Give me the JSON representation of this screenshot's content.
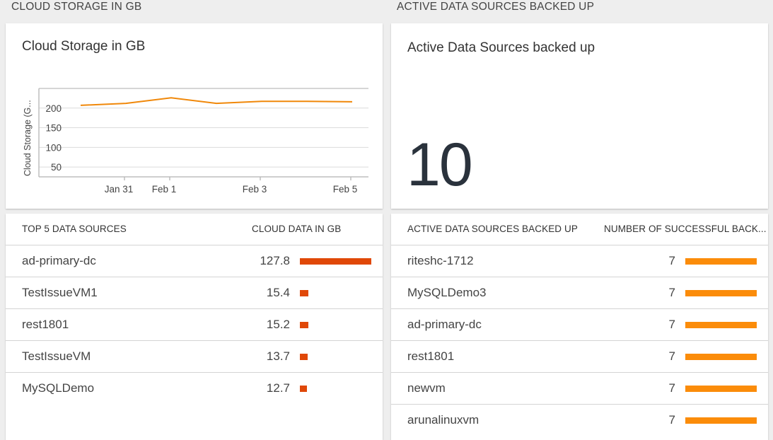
{
  "sections": {
    "left_title": "CLOUD STORAGE IN GB",
    "right_title": "ACTIVE DATA SOURCES BACKED UP"
  },
  "chart_card": {
    "title": "Cloud Storage in GB"
  },
  "chart_data": {
    "type": "line",
    "ylabel": "Cloud Storage (G...",
    "xlabel": "",
    "y_ticks": [
      "50",
      "100",
      "150",
      "200"
    ],
    "ylim": [
      25,
      250
    ],
    "x_ticks": [
      "Jan 31",
      "Feb 1",
      "Feb 3",
      "Feb 5"
    ],
    "series": [
      {
        "x": [
          "Jan 30",
          "Jan 31",
          "Feb 1",
          "Feb 2",
          "Feb 3",
          "Feb 4",
          "Feb 5"
        ],
        "values": [
          207,
          212,
          226,
          212,
          217,
          217,
          216
        ]
      }
    ],
    "grid": true,
    "line_color": "#f0880a"
  },
  "big_card": {
    "title": "Active Data Sources backed up",
    "value": "10"
  },
  "left_table": {
    "col1_header": "TOP 5 DATA SOURCES",
    "col2_header": "CLOUD DATA IN GB",
    "bar_color": "#e04808",
    "max": 127.8,
    "rows": [
      {
        "name": "ad-primary-dc",
        "value": "127.8",
        "num": 127.8
      },
      {
        "name": "TestIssueVM1",
        "value": "15.4",
        "num": 15.4
      },
      {
        "name": "rest1801",
        "value": "15.2",
        "num": 15.2
      },
      {
        "name": "TestIssueVM",
        "value": "13.7",
        "num": 13.7
      },
      {
        "name": "MySQLDemo",
        "value": "12.7",
        "num": 12.7
      }
    ]
  },
  "right_table": {
    "col1_header": "ACTIVE DATA SOURCES BACKED UP",
    "col2_header": "NUMBER OF SUCCESSFUL BACK...",
    "bar_color": "#fb8c0a",
    "max": 7,
    "rows": [
      {
        "name": "riteshc-1712",
        "value": "7",
        "num": 7
      },
      {
        "name": "MySQLDemo3",
        "value": "7",
        "num": 7
      },
      {
        "name": "ad-primary-dc",
        "value": "7",
        "num": 7
      },
      {
        "name": "rest1801",
        "value": "7",
        "num": 7
      },
      {
        "name": "newvm",
        "value": "7",
        "num": 7
      },
      {
        "name": "arunalinuxvm",
        "value": "7",
        "num": 7
      }
    ]
  }
}
